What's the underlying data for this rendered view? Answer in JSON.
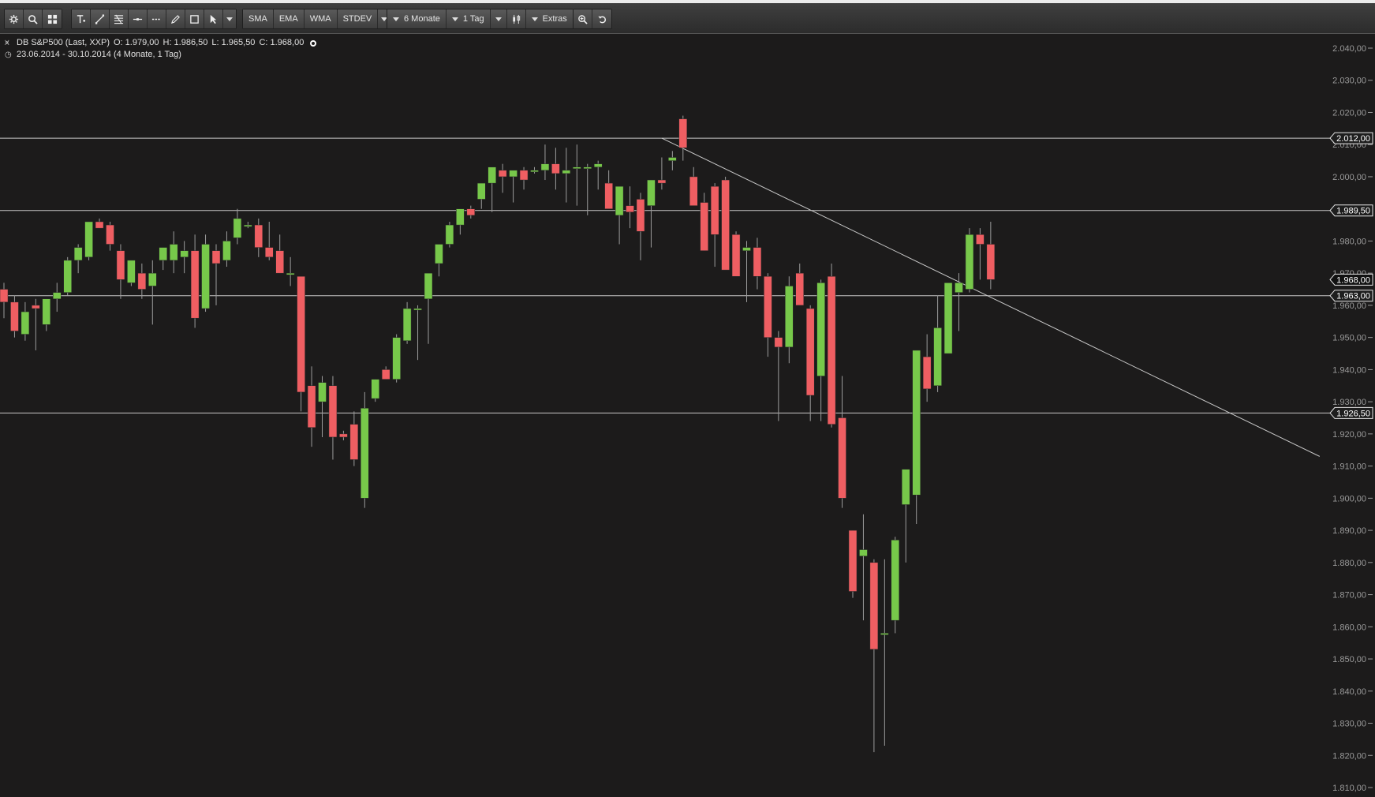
{
  "toolbar": {
    "tools_left": [
      "settings-icon",
      "search-icon",
      "grid-icon"
    ],
    "tools_draw": [
      "text-tool-icon",
      "line-tool-icon",
      "fibonacci-tool-icon",
      "horizontal-line-icon",
      "dashed-line-icon",
      "pencil-icon",
      "rectangle-icon",
      "cursor-icon",
      "chevron-down-icon"
    ],
    "indicators": [
      "SMA",
      "EMA",
      "WMA",
      "STDEV"
    ],
    "period_label": "6 Monate",
    "interval_label": "1 Tag",
    "extras_label": "Extras"
  },
  "info": {
    "instrument": "DB S&P500 (Last, XXP)",
    "open": "O: 1.979,00",
    "high": "H: 1.986,50",
    "low": "L: 1.965,50",
    "close": "C: 1.968,00",
    "range": "23.06.2014 - 30.10.2014 (4 Monate, 1 Tag)"
  },
  "chart_data": {
    "type": "candlestick",
    "ylim": [
      1810,
      2040
    ],
    "y_ticks": [
      "2.040,00",
      "2.030,00",
      "2.020,00",
      "2.010,00",
      "2.000,00",
      "1.990,00",
      "1.980,00",
      "1.970,00",
      "1.960,00",
      "1.950,00",
      "1.940,00",
      "1.930,00",
      "1.920,00",
      "1.910,00",
      "1.900,00",
      "1.890,00",
      "1.880,00",
      "1.870,00",
      "1.860,00",
      "1.850,00",
      "1.840,00",
      "1.830,00",
      "1.820,00",
      "1.810,00"
    ],
    "y_tick_values": [
      2040,
      2030,
      2020,
      2010,
      2000,
      1990,
      1980,
      1970,
      1960,
      1950,
      1940,
      1930,
      1920,
      1910,
      1900,
      1890,
      1880,
      1870,
      1860,
      1850,
      1840,
      1830,
      1820,
      1810
    ],
    "candles": [
      {
        "o": 1965,
        "h": 1967,
        "l": 1956,
        "c": 1961
      },
      {
        "o": 1961,
        "h": 1963,
        "l": 1950,
        "c": 1952
      },
      {
        "o": 1951,
        "h": 1961,
        "l": 1949,
        "c": 1958
      },
      {
        "o": 1960,
        "h": 1962,
        "l": 1946,
        "c": 1959
      },
      {
        "o": 1954,
        "h": 1962,
        "l": 1952,
        "c": 1962
      },
      {
        "o": 1962,
        "h": 1967,
        "l": 1958,
        "c": 1964
      },
      {
        "o": 1964,
        "h": 1975,
        "l": 1963,
        "c": 1974
      },
      {
        "o": 1974,
        "h": 1979,
        "l": 1970,
        "c": 1978
      },
      {
        "o": 1975,
        "h": 1986,
        "l": 1974,
        "c": 1986
      },
      {
        "o": 1986,
        "h": 1987,
        "l": 1984,
        "c": 1984
      },
      {
        "o": 1985,
        "h": 1986,
        "l": 1977,
        "c": 1979
      },
      {
        "o": 1977,
        "h": 1979,
        "l": 1962,
        "c": 1968
      },
      {
        "o": 1967,
        "h": 1973,
        "l": 1966,
        "c": 1974
      },
      {
        "o": 1970,
        "h": 1973,
        "l": 1962,
        "c": 1965
      },
      {
        "o": 1966,
        "h": 1974,
        "l": 1954,
        "c": 1970
      },
      {
        "o": 1974,
        "h": 1978,
        "l": 1971,
        "c": 1978
      },
      {
        "o": 1974,
        "h": 1983,
        "l": 1970,
        "c": 1979
      },
      {
        "o": 1975,
        "h": 1980,
        "l": 1970,
        "c": 1977
      },
      {
        "o": 1977,
        "h": 1982,
        "l": 1953,
        "c": 1956
      },
      {
        "o": 1959,
        "h": 1982,
        "l": 1958,
        "c": 1979
      },
      {
        "o": 1977,
        "h": 1979,
        "l": 1960,
        "c": 1973
      },
      {
        "o": 1974,
        "h": 1983,
        "l": 1972,
        "c": 1980
      },
      {
        "o": 1981,
        "h": 1990,
        "l": 1979,
        "c": 1987
      },
      {
        "o": 1985,
        "h": 1986,
        "l": 1984,
        "c": 1985
      },
      {
        "o": 1985,
        "h": 1987,
        "l": 1975,
        "c": 1978
      },
      {
        "o": 1978,
        "h": 1986,
        "l": 1974,
        "c": 1975
      },
      {
        "o": 1977,
        "h": 1982,
        "l": 1970,
        "c": 1970
      },
      {
        "o": 1970,
        "h": 1975,
        "l": 1966,
        "c": 1970
      },
      {
        "o": 1969,
        "h": 1969,
        "l": 1927,
        "c": 1933
      },
      {
        "o": 1935,
        "h": 1941,
        "l": 1916,
        "c": 1922
      },
      {
        "o": 1930,
        "h": 1938,
        "l": 1919,
        "c": 1936
      },
      {
        "o": 1935,
        "h": 1938,
        "l": 1912,
        "c": 1919
      },
      {
        "o": 1920,
        "h": 1921,
        "l": 1918,
        "c": 1919
      },
      {
        "o": 1923,
        "h": 1927,
        "l": 1910,
        "c": 1912
      },
      {
        "o": 1900,
        "h": 1933,
        "l": 1897,
        "c": 1928
      },
      {
        "o": 1931,
        "h": 1937,
        "l": 1930,
        "c": 1937
      },
      {
        "o": 1940,
        "h": 1941,
        "l": 1937,
        "c": 1937
      },
      {
        "o": 1937,
        "h": 1951,
        "l": 1936,
        "c": 1950
      },
      {
        "o": 1949,
        "h": 1961,
        "l": 1948,
        "c": 1959
      },
      {
        "o": 1959,
        "h": 1960,
        "l": 1943,
        "c": 1959
      },
      {
        "o": 1962,
        "h": 1967,
        "l": 1948,
        "c": 1970
      },
      {
        "o": 1973,
        "h": 1976,
        "l": 1969,
        "c": 1979
      },
      {
        "o": 1979,
        "h": 1986,
        "l": 1978,
        "c": 1985
      },
      {
        "o": 1985,
        "h": 1987,
        "l": 1982,
        "c": 1990
      },
      {
        "o": 1990,
        "h": 1991,
        "l": 1987,
        "c": 1988
      },
      {
        "o": 1993,
        "h": 1997,
        "l": 1990,
        "c": 1998
      },
      {
        "o": 1998,
        "h": 2001,
        "l": 1989,
        "c": 2003
      },
      {
        "o": 2002,
        "h": 2004,
        "l": 1995,
        "c": 2000
      },
      {
        "o": 2000,
        "h": 2001,
        "l": 1992,
        "c": 2002
      },
      {
        "o": 2002,
        "h": 2003,
        "l": 1996,
        "c": 1999
      },
      {
        "o": 2002,
        "h": 2003,
        "l": 2001,
        "c": 2002
      },
      {
        "o": 2002,
        "h": 2010,
        "l": 1999,
        "c": 2004
      },
      {
        "o": 2004,
        "h": 2009,
        "l": 1996,
        "c": 2001
      },
      {
        "o": 2001,
        "h": 2009,
        "l": 1992,
        "c": 2002
      },
      {
        "o": 2003,
        "h": 2010,
        "l": 1991,
        "c": 2003
      },
      {
        "o": 2003,
        "h": 2004,
        "l": 1988,
        "c": 2003
      },
      {
        "o": 2003,
        "h": 2005,
        "l": 1996,
        "c": 2004
      },
      {
        "o": 1998,
        "h": 2002,
        "l": 1993,
        "c": 1990
      },
      {
        "o": 1988,
        "h": 1993,
        "l": 1979,
        "c": 1997
      },
      {
        "o": 1991,
        "h": 1997,
        "l": 1984,
        "c": 1989
      },
      {
        "o": 1993,
        "h": 1995,
        "l": 1974,
        "c": 1983
      },
      {
        "o": 1991,
        "h": 1997,
        "l": 1978,
        "c": 1999
      },
      {
        "o": 1999,
        "h": 2006,
        "l": 1996,
        "c": 1998
      },
      {
        "o": 2005,
        "h": 2008,
        "l": 2002,
        "c": 2006
      },
      {
        "o": 2018,
        "h": 2019,
        "l": 2005,
        "c": 2009
      },
      {
        "o": 2000,
        "h": 2003,
        "l": 1992,
        "c": 1991
      },
      {
        "o": 1992,
        "h": 1995,
        "l": 1977,
        "c": 1977
      },
      {
        "o": 1997,
        "h": 1998,
        "l": 1972,
        "c": 1982
      },
      {
        "o": 1999,
        "h": 2000,
        "l": 1974,
        "c": 1971
      },
      {
        "o": 1982,
        "h": 1983,
        "l": 1970,
        "c": 1969
      },
      {
        "o": 1977,
        "h": 1980,
        "l": 1961,
        "c": 1978
      },
      {
        "o": 1978,
        "h": 1981,
        "l": 1965,
        "c": 1969
      },
      {
        "o": 1969,
        "h": 1970,
        "l": 1944,
        "c": 1950
      },
      {
        "o": 1950,
        "h": 1952,
        "l": 1924,
        "c": 1947
      },
      {
        "o": 1947,
        "h": 1969,
        "l": 1942,
        "c": 1966
      },
      {
        "o": 1970,
        "h": 1973,
        "l": 1961,
        "c": 1960
      },
      {
        "o": 1959,
        "h": 1960,
        "l": 1924,
        "c": 1932
      },
      {
        "o": 1938,
        "h": 1968,
        "l": 1924,
        "c": 1967
      },
      {
        "o": 1969,
        "h": 1973,
        "l": 1922,
        "c": 1923
      },
      {
        "o": 1925,
        "h": 1938,
        "l": 1897,
        "c": 1900
      },
      {
        "o": 1890,
        "h": 1890,
        "l": 1869,
        "c": 1871
      },
      {
        "o": 1882,
        "h": 1895,
        "l": 1862,
        "c": 1884
      },
      {
        "o": 1880,
        "h": 1881,
        "l": 1821,
        "c": 1853
      },
      {
        "o": 1858,
        "h": 1881,
        "l": 1823,
        "c": 1858
      },
      {
        "o": 1862,
        "h": 1888,
        "l": 1858,
        "c": 1887
      },
      {
        "o": 1898,
        "h": 1908,
        "l": 1880,
        "c": 1909
      },
      {
        "o": 1901,
        "h": 1945,
        "l": 1892,
        "c": 1946
      },
      {
        "o": 1944,
        "h": 1951,
        "l": 1930,
        "c": 1934
      },
      {
        "o": 1935,
        "h": 1963,
        "l": 1933,
        "c": 1953
      },
      {
        "o": 1945,
        "h": 1966,
        "l": 1945,
        "c": 1967
      },
      {
        "o": 1964,
        "h": 1970,
        "l": 1952,
        "c": 1967
      },
      {
        "o": 1965,
        "h": 1984,
        "l": 1964,
        "c": 1982
      },
      {
        "o": 1982,
        "h": 1984,
        "l": 1968,
        "c": 1979
      },
      {
        "o": 1979,
        "h": 1986,
        "l": 1965,
        "c": 1968
      }
    ],
    "hlines": [
      {
        "value": 2012,
        "label": "2.012,00"
      },
      {
        "value": 1989.5,
        "label": "1.989,50"
      },
      {
        "value": 1963,
        "label": "1.963,00"
      },
      {
        "value": 1926.5,
        "label": "1.926,50"
      }
    ],
    "current_price": {
      "value": 1968,
      "label": "1.968,00"
    },
    "trendline": [
      {
        "candle": 62,
        "value": 2012
      },
      {
        "candle": 124,
        "value": 1913
      }
    ],
    "colors": {
      "up": "#77c84a",
      "down": "#ef5e62",
      "background": "#1c1b1b",
      "lines": "#c8c8c8"
    }
  }
}
